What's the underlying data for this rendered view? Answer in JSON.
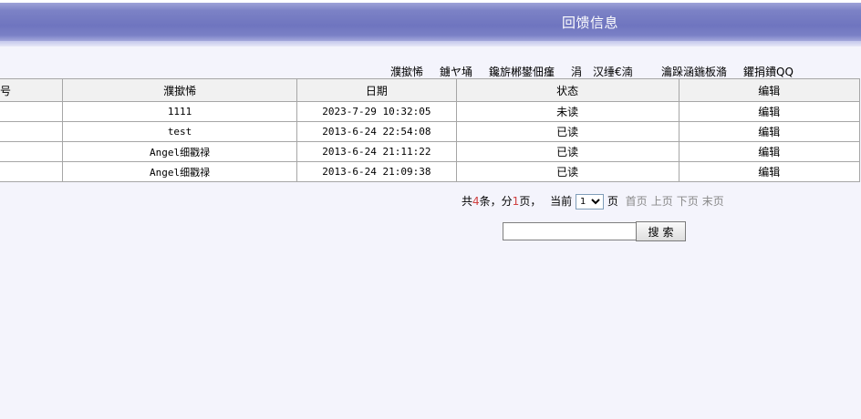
{
  "header": {
    "title": "回馈信息"
  },
  "toolbar": {
    "links": [
      "濮撳悕",
      "鐪ヤ埇",
      "鑱旂郴鐢佃瘽",
      "涓",
      "汉缍€湳",
      "瀹跺涵鍦板潃",
      "鑺捐鐨QQ"
    ]
  },
  "table": {
    "columns": [
      "号",
      "濮撳悕",
      "日期",
      "状态",
      "编辑"
    ],
    "rows": [
      {
        "name": "1111",
        "date": "2023-7-29 10:32:05",
        "status": "未读",
        "edit": "编辑"
      },
      {
        "name": "test",
        "date": "2013-6-24 22:54:08",
        "status": "已读",
        "edit": "编辑"
      },
      {
        "name": "Angel细戳禄",
        "date": "2013-6-24 21:11:22",
        "status": "已读",
        "edit": "编辑"
      },
      {
        "name": "Angel细戳禄",
        "date": "2013-6-24 21:09:38",
        "status": "已读",
        "edit": "编辑"
      }
    ]
  },
  "pager": {
    "total_prefix": "共",
    "total_count": "4",
    "total_suffix": "条，分",
    "page_count": "1",
    "page_suffix": "页，",
    "current_label": "当前",
    "current_page": "1",
    "page_unit": "页",
    "first": "首页",
    "prev": "上页",
    "next": "下页",
    "last": "末页"
  },
  "search": {
    "value": "",
    "button_label": "搜索"
  }
}
